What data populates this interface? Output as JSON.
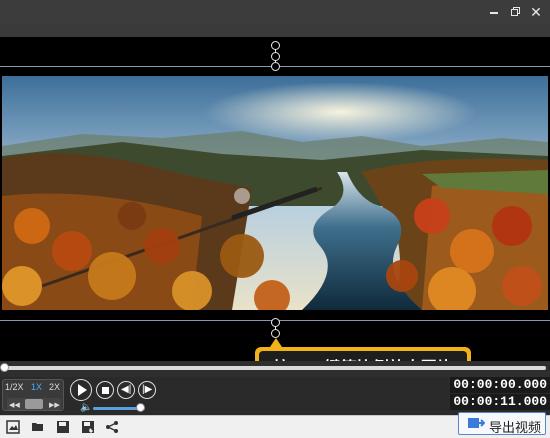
{
  "window": {
    "controls": {
      "minimize_icon": "minimize-icon",
      "restore_icon": "restore-icon",
      "close_icon": "close-icon",
      "close_glyph": "✕"
    }
  },
  "tooltip": {
    "text": "按Shift键等比例放大图片"
  },
  "player": {
    "speed_options": [
      "1/2X",
      "1X",
      "2X"
    ],
    "active_speed": "1X",
    "current_time": "00:00:00.000",
    "total_time": "00:00:11.000",
    "progress": 0.0,
    "volume": 0.9
  },
  "toolbar": {
    "icons": [
      "image-icon",
      "folder-open-icon",
      "save-icon",
      "save-as-icon",
      "share-icon"
    ],
    "export_label": "导出视频"
  },
  "colors": {
    "accent": "#4aa9ff",
    "tooltip_border": "#f2b218",
    "export_border": "#5c86c7"
  }
}
